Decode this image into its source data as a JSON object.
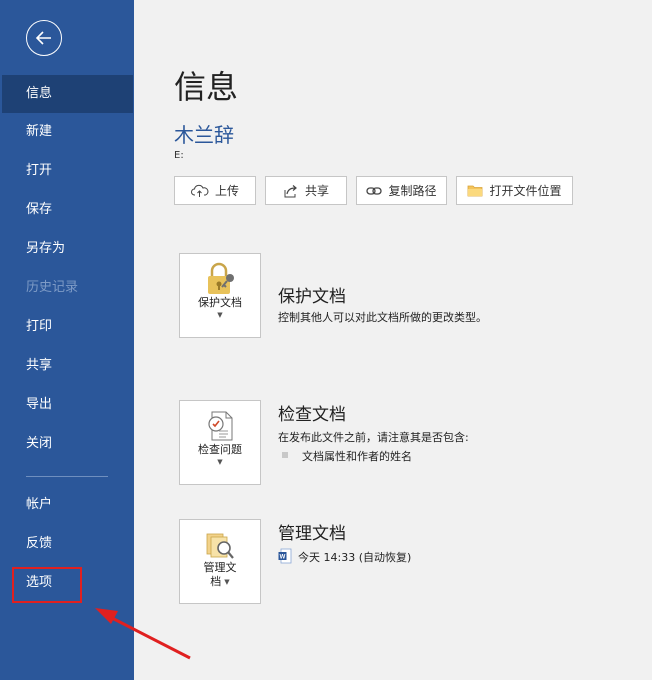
{
  "sidebar": {
    "items": [
      {
        "label": "信息"
      },
      {
        "label": "新建"
      },
      {
        "label": "打开"
      },
      {
        "label": "保存"
      },
      {
        "label": "另存为"
      },
      {
        "label": "历史记录"
      },
      {
        "label": "打印"
      },
      {
        "label": "共享"
      },
      {
        "label": "导出"
      },
      {
        "label": "关闭"
      },
      {
        "label": "帐户"
      },
      {
        "label": "反馈"
      },
      {
        "label": "选项"
      }
    ]
  },
  "main": {
    "title": "信息",
    "doc_name": "木兰辞",
    "doc_path": "E:",
    "buttons": {
      "upload": "上传",
      "share": "共享",
      "copy_path": "复制路径",
      "open_location": "打开文件位置"
    },
    "protect": {
      "card_label": "保护文档",
      "title": "保护文档",
      "desc": "控制其他人可以对此文档所做的更改类型。"
    },
    "inspect": {
      "card_label": "检查问题",
      "title": "检查文档",
      "desc": "在发布此文件之前，请注意其是否包含:",
      "bullet": "文档属性和作者的姓名"
    },
    "manage": {
      "card_label_1": "管理文",
      "card_label_2": "档",
      "title": "管理文档",
      "version": "今天 14:33 (自动恢复)"
    }
  },
  "colors": {
    "sidebar": "#2b579a",
    "active_item": "#1e4175",
    "highlight": "#e02020"
  }
}
